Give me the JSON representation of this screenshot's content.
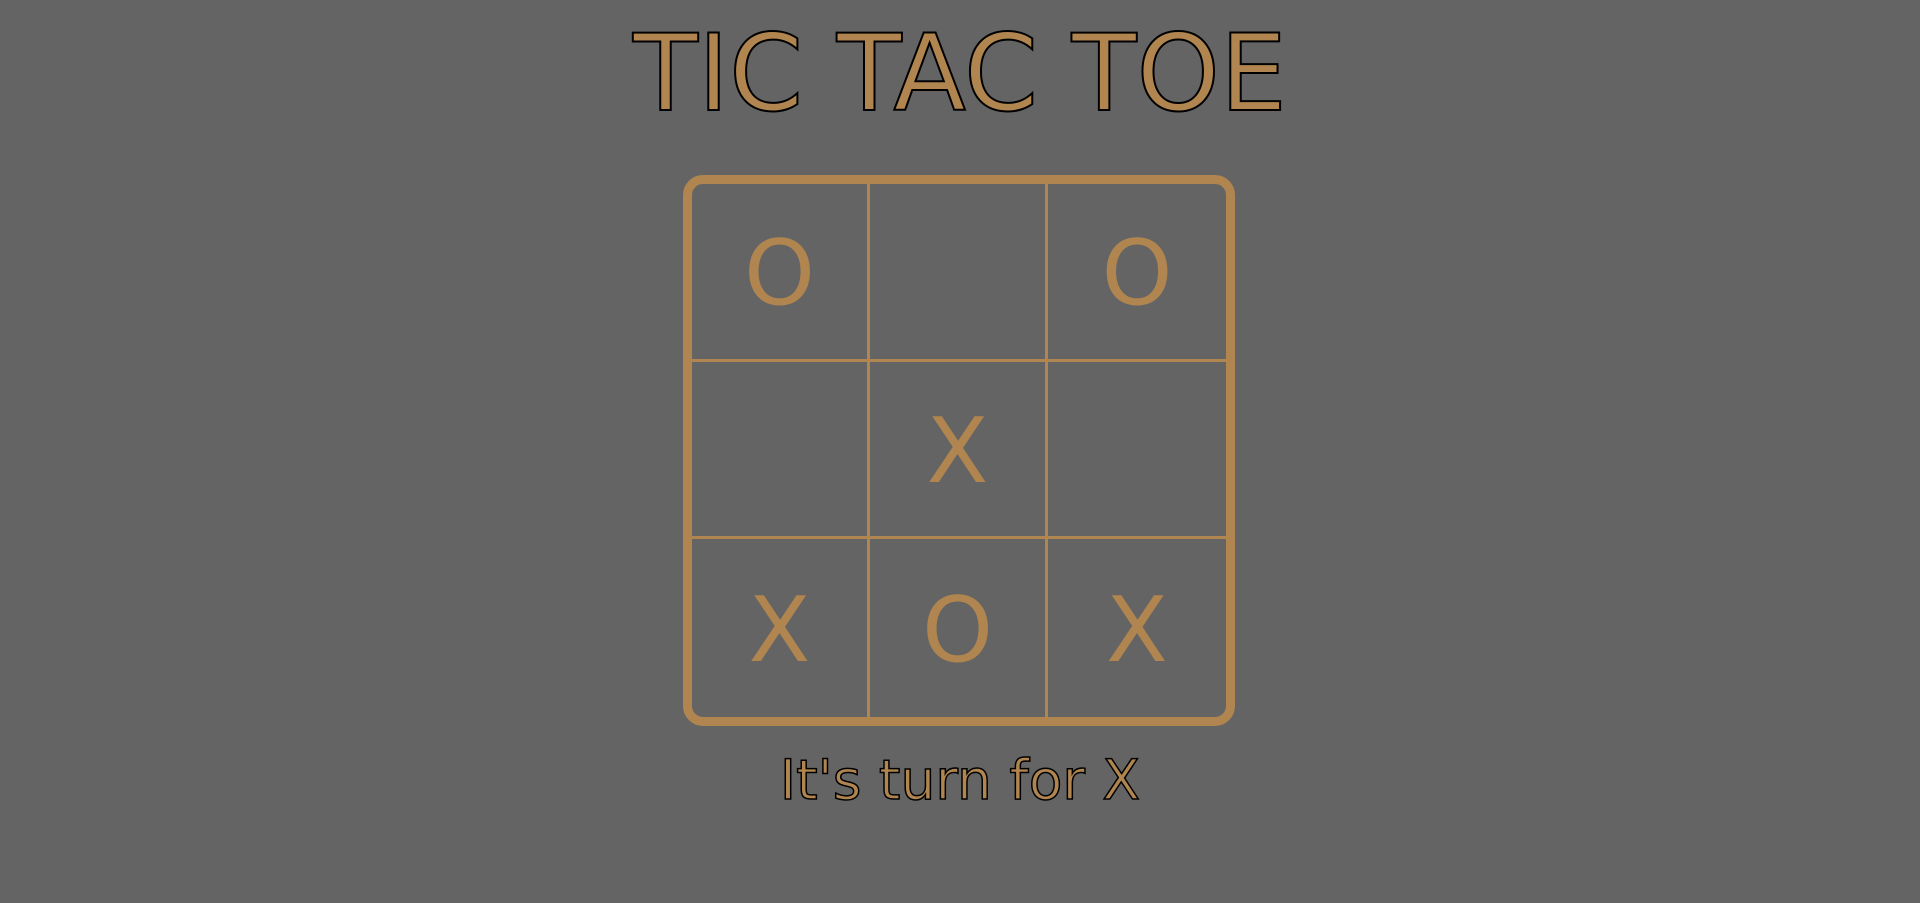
{
  "title": "TIC TAC TOE",
  "board": {
    "cells": [
      [
        "O",
        "",
        "O"
      ],
      [
        "",
        "X",
        ""
      ],
      [
        "X",
        "O",
        "X"
      ]
    ]
  },
  "status": "It's turn for X",
  "colors": {
    "background": "#646464",
    "accent": "#b0854f",
    "outline": "#000000"
  }
}
